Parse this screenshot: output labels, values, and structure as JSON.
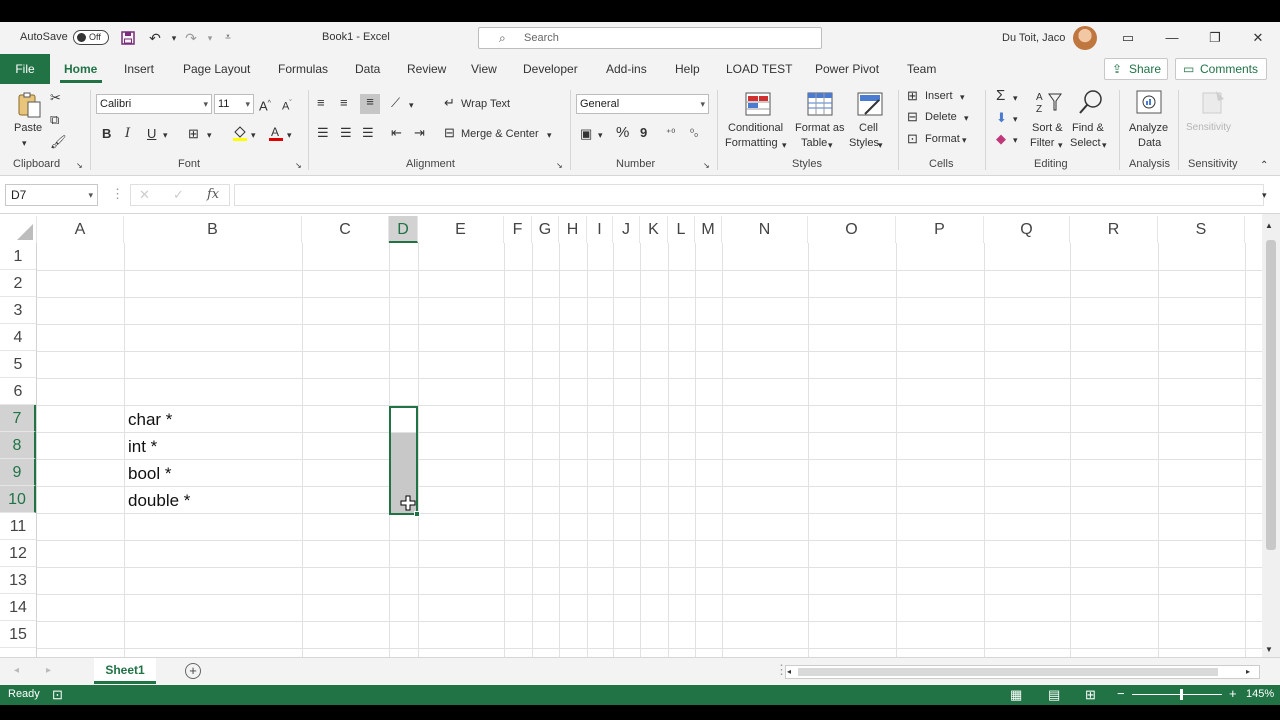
{
  "titlebar": {
    "autosave_label": "AutoSave",
    "autosave_state": "Off",
    "doc_title": "Book1  -  Excel",
    "search_placeholder": "Search",
    "user_name": "Du Toit, Jaco"
  },
  "tabs": {
    "file": "File",
    "items": [
      "Home",
      "Insert",
      "Page Layout",
      "Formulas",
      "Data",
      "Review",
      "View",
      "Developer",
      "Add-ins",
      "Help",
      "LOAD TEST",
      "Power Pivot",
      "Team"
    ],
    "active": "Home",
    "share": "Share",
    "comments": "Comments"
  },
  "ribbon": {
    "clipboard": {
      "paste": "Paste",
      "label": "Clipboard"
    },
    "font": {
      "name": "Calibri",
      "size": "11",
      "bold": "B",
      "italic": "I",
      "underline": "U",
      "label": "Font"
    },
    "alignment": {
      "wrap": "Wrap Text",
      "merge": "Merge & Center",
      "label": "Alignment"
    },
    "number": {
      "format": "General",
      "percent": "%",
      "comma": "9",
      "label": "Number"
    },
    "styles": {
      "conditional_1": "Conditional",
      "conditional_2": "Formatting",
      "table_1": "Format as",
      "table_2": "Table",
      "cell_1": "Cell",
      "cell_2": "Styles",
      "label": "Styles"
    },
    "cells": {
      "insert": "Insert",
      "delete": "Delete",
      "format": "Format",
      "label": "Cells"
    },
    "editing": {
      "sort_1": "Sort &",
      "sort_2": "Filter",
      "find_1": "Find &",
      "find_2": "Select",
      "label": "Editing"
    },
    "analysis": {
      "analyze_1": "Analyze",
      "analyze_2": "Data",
      "label": "Analysis"
    },
    "sensitivity": {
      "button": "Sensitivity",
      "label": "Sensitivity"
    }
  },
  "formula_bar": {
    "name_box": "D7",
    "fx": "fx",
    "value": ""
  },
  "grid": {
    "columns": [
      "A",
      "B",
      "C",
      "D",
      "E",
      "F",
      "G",
      "H",
      "I",
      "J",
      "K",
      "L",
      "M",
      "N",
      "O",
      "P",
      "Q",
      "R",
      "S"
    ],
    "rows": [
      "1",
      "2",
      "3",
      "4",
      "5",
      "6",
      "7",
      "8",
      "9",
      "10",
      "11",
      "12",
      "13",
      "14",
      "15"
    ],
    "selected_column": "D",
    "selected_rows": [
      "7",
      "8",
      "9",
      "10"
    ],
    "cells": {
      "B7": "char *",
      "B8": "int *",
      "B9": "bool *",
      "B10": "double *"
    }
  },
  "sheets": {
    "tabs": [
      "Sheet1"
    ],
    "active": "Sheet1"
  },
  "status": {
    "ready": "Ready",
    "zoom": "145%"
  },
  "colors": {
    "accent": "#217346"
  }
}
